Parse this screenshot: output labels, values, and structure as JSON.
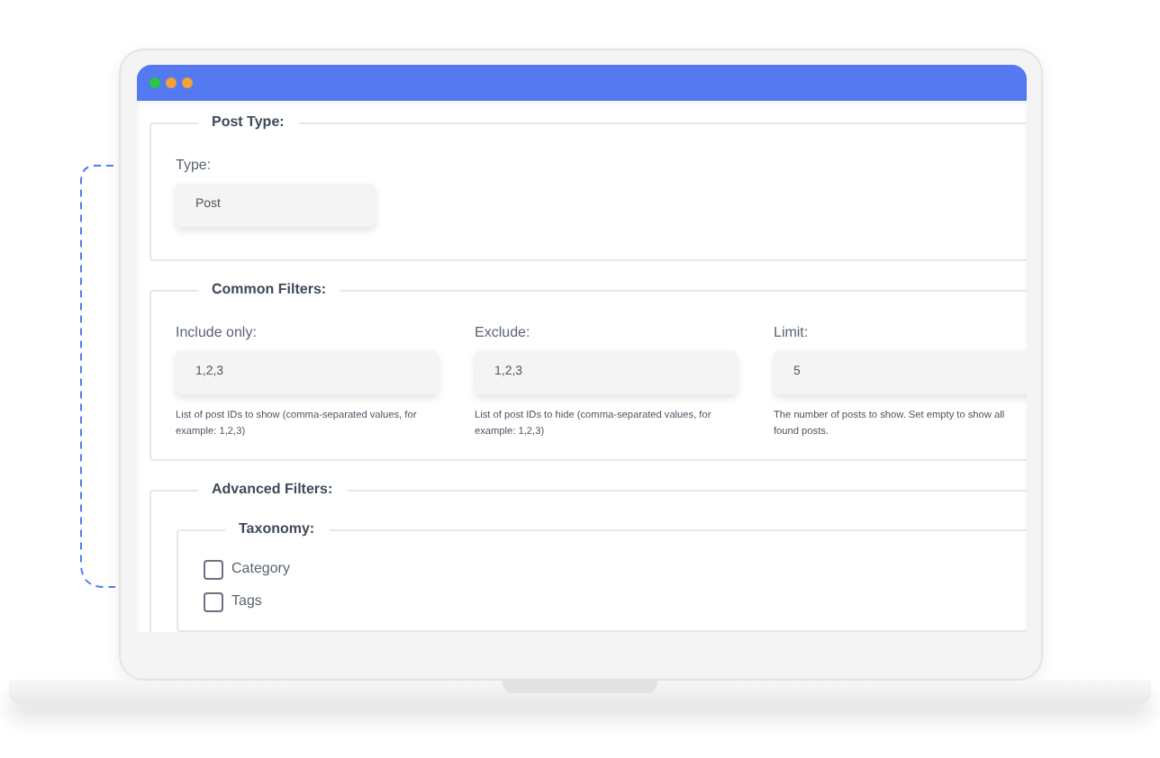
{
  "sections": [
    {
      "kind": "fields",
      "legend": "Post Type:",
      "fields": [
        {
          "label": "Type:",
          "value": "Post"
        }
      ]
    },
    {
      "kind": "fields",
      "legend": "Common Filters:",
      "fields": [
        {
          "label": "Include only:",
          "value": "1,2,3",
          "help": "List of post IDs to show (comma-separated values, for example: 1,2,3)"
        },
        {
          "label": "Exclude:",
          "value": "1,2,3",
          "help": "List of post IDs to hide (comma-separated values, for example: 1,2,3)"
        },
        {
          "label": "Limit:",
          "value": "5",
          "help": "The number of posts to show. Set empty to show all found posts."
        }
      ]
    },
    {
      "kind": "groups",
      "legend": "Advanced Filters:",
      "groups": [
        {
          "legend": "Taxonomy:",
          "options": [
            {
              "label": "Category",
              "checked": false
            },
            {
              "label": "Tags",
              "checked": false
            }
          ]
        }
      ]
    }
  ]
}
